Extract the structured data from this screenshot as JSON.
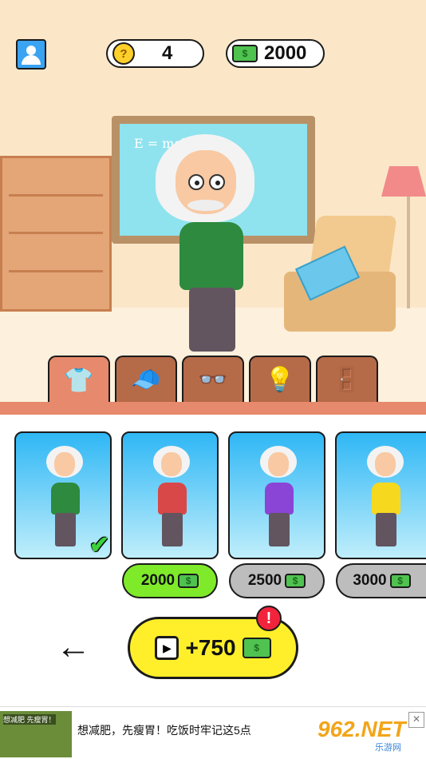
{
  "header": {
    "bulbs": "4",
    "cash": "2000",
    "avatar_icon": "user-icon",
    "bulb_icon": "lightbulb-icon",
    "cash_icon": "cash-stack-icon"
  },
  "scene": {
    "formula": "E = mc²"
  },
  "tabs": [
    {
      "name": "shirt",
      "icon": "shirt-icon",
      "glyph": "👕",
      "active": true
    },
    {
      "name": "hat",
      "icon": "cap-icon",
      "glyph": "🧢",
      "active": false
    },
    {
      "name": "glasses",
      "icon": "glasses-icon",
      "glyph": "👓",
      "active": false
    },
    {
      "name": "bulb",
      "icon": "lightbulb-icon",
      "glyph": "💡",
      "active": false
    },
    {
      "name": "shop",
      "icon": "door-cash-icon",
      "glyph": "🚪",
      "active": false
    }
  ],
  "outfits": [
    {
      "shirt_color": "#2e8a3e",
      "owned": true,
      "price": ""
    },
    {
      "shirt_color": "#d84848",
      "owned": false,
      "price": "2000",
      "price_bg": "#7fea2a"
    },
    {
      "shirt_color": "#8a44d6",
      "owned": false,
      "price": "2500",
      "price_bg": "#bdbdbd"
    },
    {
      "shirt_color": "#f6d91f",
      "owned": false,
      "price": "3000",
      "price_bg": "#bdbdbd"
    }
  ],
  "footer": {
    "back_glyph": "←",
    "reward": "+750",
    "alert": "!"
  },
  "ad": {
    "image_caption": "想减肥 先瘦胃！",
    "text": "想减肥，先瘦胃！吃饭时牢记这5点",
    "logo": "962.NET",
    "logo_sub": "乐游网",
    "close": "✕"
  }
}
